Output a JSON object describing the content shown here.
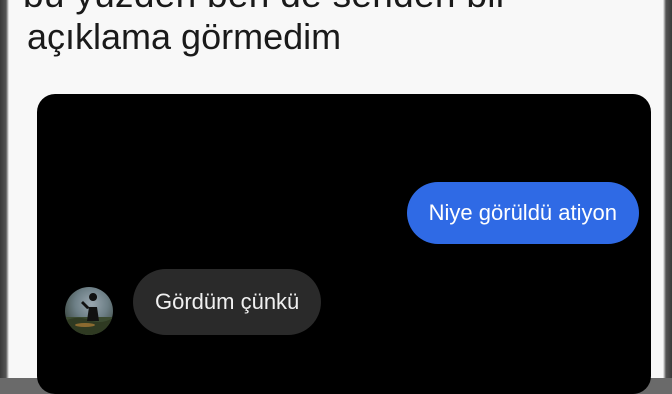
{
  "post": {
    "cut_line": "bu yüzden ben de senden bir",
    "text": "açıklama görmedim"
  },
  "chat": {
    "sent_message": "Niye görüldü atiyon",
    "received_message": "Gördüm çünkü",
    "avatar_icon": "profile-photo-silhouette-icon"
  },
  "colors": {
    "sent_bubble": "#2f6ae5",
    "received_bubble": "#2a2a2a",
    "chat_background": "#000000"
  }
}
